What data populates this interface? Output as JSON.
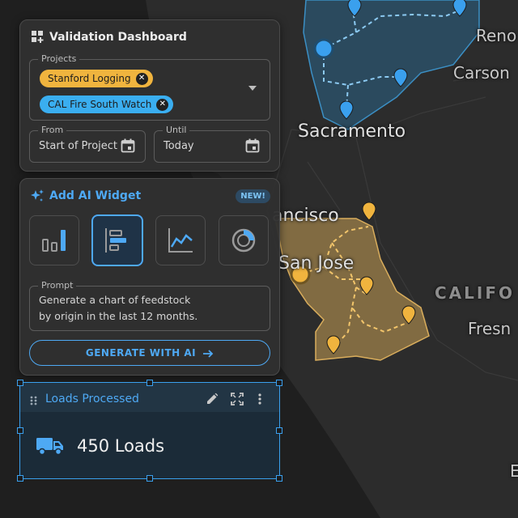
{
  "map": {
    "labels": {
      "reno": "Reno",
      "carson": "Carson",
      "sacramento": "Sacramento",
      "francisco": "ancisco",
      "sanjose": "San Jose",
      "california": "CALIFO",
      "fresno": "Fresn",
      "edge_e": "E"
    },
    "colors": {
      "blue_region": "#2a6f9c",
      "gold_region": "#c9a055"
    }
  },
  "dashboard": {
    "title": "Validation Dashboard",
    "icon": "dashboard-add-icon",
    "projects_label": "Projects",
    "chips": [
      {
        "label": "Stanford Logging",
        "color": "#f0b43e"
      },
      {
        "label": "CAL Fire South Watch",
        "color": "#3aaef0"
      }
    ],
    "from_label": "From",
    "from_value": "Start of Project",
    "until_label": "Until",
    "until_value": "Today"
  },
  "ai_widget": {
    "title": "Add AI Widget",
    "badge": "NEW!",
    "widget_types": [
      "bar-chart-icon",
      "horizontal-bar-icon",
      "line-chart-icon",
      "donut-chart-icon"
    ],
    "selected_index": 1,
    "prompt_label": "Prompt",
    "prompt_line1": "Generate a chart of feedstock",
    "prompt_line2": "by origin in the last 12 months.",
    "generate_label": "GENERATE WITH AI"
  },
  "loads_widget": {
    "title": "Loads Processed",
    "value": "450 Loads",
    "icon": "truck-icon"
  },
  "accent": "#4ea9f4"
}
